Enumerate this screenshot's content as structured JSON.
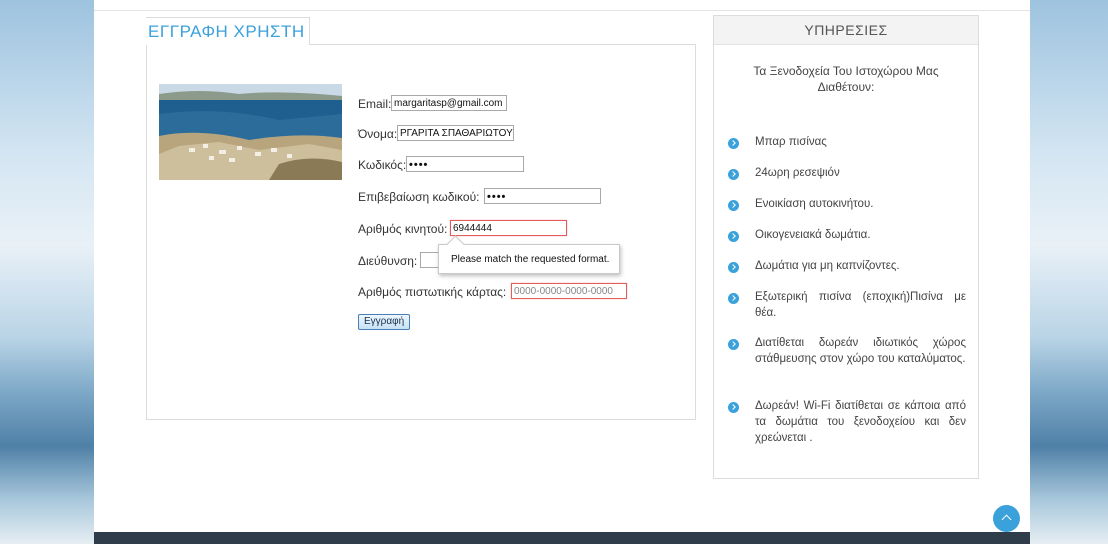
{
  "registration": {
    "title": "ΕΓΓΡΑΦΗ ΧΡΗΣΤΗ",
    "fields": {
      "email": {
        "label": "Email:",
        "value": "margaritasp@gmail.com"
      },
      "name": {
        "label": "Όνομα:",
        "value": "ΡΓΑΡΙΤΑ ΣΠΑΘΑΡΙΩΤΟΥ"
      },
      "password": {
        "label": "Κωδικός:",
        "value": "••••"
      },
      "confirm_password": {
        "label": "Επιβεβαίωση κωδικού:",
        "value": "••••"
      },
      "mobile": {
        "label": "Αριθμός κινητού:",
        "value": "6944444"
      },
      "address": {
        "label": "Διεύθυνση:",
        "value": ""
      },
      "credit_card": {
        "label": "Αριθμός πιστωτικής κάρτας:",
        "placeholder": "0000-0000-0000-0000"
      }
    },
    "submit_label": "Εγγραφή",
    "validation_tooltip": "Please match the requested format."
  },
  "services": {
    "title": "ΥΠΗΡΕΣΙΕΣ",
    "intro": "Τα Ξενοδοχεία Του Ιστοχώρου Μας Διαθέτουν:",
    "items": [
      "Μπαρ πισίνας",
      "24ωρη ρεσεψιόν",
      "Ενοικίαση αυτοκινήτου.",
      "Οικογενειακά δωμάτια.",
      "Δωμάτια για μη καπνίζοντες.",
      "Εξωτερική πισίνα (εποχική)Πισίνα με θέα.",
      "Διατίθεται δωρεάν ιδιωτικός χώρος στάθμευσης στον χώρο του καταλύματος.",
      "Δωρεάν! Wi-Fi διατίθεται σε κάποια από τα δωμάτια του ξενοδοχείου και δεν χρεώνεται ."
    ]
  },
  "colors": {
    "accent": "#3aa1db",
    "footer": "#2f3d4b",
    "invalid_border": "#e35d5d"
  },
  "icons": {
    "bullet": "chevron-right-circle-icon",
    "scroll_top": "chevron-up-icon"
  }
}
